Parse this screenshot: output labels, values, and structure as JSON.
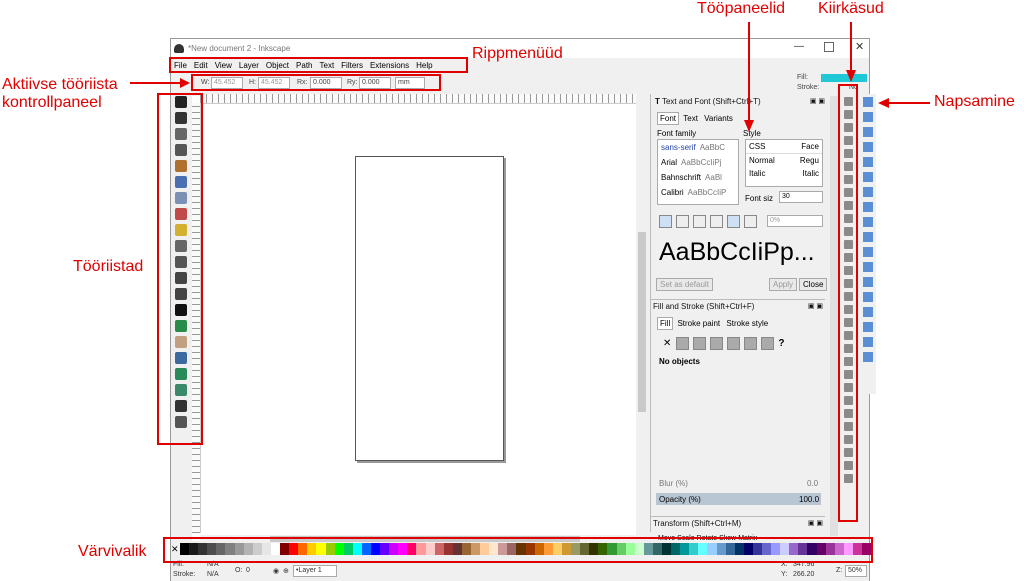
{
  "window": {
    "title": "*New document 2 - Inkscape"
  },
  "menu": [
    "File",
    "Edit",
    "View",
    "Layer",
    "Object",
    "Path",
    "Text",
    "Filters",
    "Extensions",
    "Help"
  ],
  "tool_controls": {
    "w_label": "W:",
    "w_value": "45.452",
    "h_label": "H:",
    "h_value": "45.452",
    "rx_label": "Rx:",
    "rx_value": "0.000",
    "ry_label": "Ry:",
    "ry_value": "0.000",
    "unit": "mm"
  },
  "fill_stroke_indicator": {
    "fill_label": "Fill:",
    "stroke_label": "Stroke:",
    "stroke_value": "No",
    "fill_color": "#1ec8d6"
  },
  "tools": [
    "selector-tool-icon",
    "node-tool-icon",
    "tweak-tool-icon",
    "zoom-tool-icon",
    "measure-tool-icon",
    "rectangle-tool-icon",
    "3dbox-tool-icon",
    "ellipse-tool-icon",
    "star-tool-icon",
    "spiral-tool-icon",
    "pencil-tool-icon",
    "pen-tool-icon",
    "calligraphy-tool-icon",
    "text-tool-icon",
    "spray-tool-icon",
    "eraser-tool-icon",
    "bucket-tool-icon",
    "gradient-tool-icon",
    "mesh-tool-icon",
    "dropper-tool-icon",
    "connector-tool-icon"
  ],
  "text_font_panel": {
    "title": "Text and Font (Shift+Ctrl+T)",
    "tabs": [
      "Font",
      "Text",
      "Variants"
    ],
    "font_family_label": "Font family",
    "font_families": [
      {
        "name": "sans-serif",
        "sample": "AaBbC"
      },
      {
        "name": "Arial",
        "sample": "AaBbCcIiPj"
      },
      {
        "name": "Bahnschrift",
        "sample": "AaBl"
      },
      {
        "name": "Calibri",
        "sample": "AaBbCcIiP"
      }
    ],
    "style_label": "Style",
    "style_headers": [
      "CSS",
      "Face"
    ],
    "styles": [
      [
        "Normal",
        "Regu"
      ],
      [
        "Italic",
        "Italic"
      ]
    ],
    "font_size_label": "Font siz",
    "font_size_value": "30",
    "spacing_value": "0%",
    "preview_text": "AaBbCcIiPp...",
    "set_default_button": "Set as default",
    "apply_button": "Apply",
    "close_button": "Close"
  },
  "fill_stroke_panel": {
    "title": "Fill and Stroke (Shift+Ctrl+F)",
    "tabs": [
      "Fill",
      "Stroke paint",
      "Stroke style"
    ],
    "status": "No objects",
    "unknown_paint": "?",
    "blur_label": "Blur (%)",
    "blur_value": "0.0",
    "opacity_label": "Opacity (%)",
    "opacity_value": "100.0"
  },
  "transform_panel": {
    "title": "Transform (Shift+Ctrl+M)",
    "tabs": [
      "Move",
      "Scale",
      "Rotate",
      "Skew",
      "Matrix"
    ]
  },
  "statusbar": {
    "fill_label": "Fill:",
    "fill_value": "N/A",
    "stroke_label": "Stroke:",
    "stroke_value": "N/A",
    "opacity_label": "O:",
    "opacity_value": "0",
    "layer": "•Layer 1",
    "x_label": "X:",
    "x_value": "347.96",
    "y_label": "Y:",
    "y_value": "266.20",
    "zoom_label": "Z:",
    "zoom_value": "50%"
  },
  "palette": [
    "#000000",
    "#1a1a1a",
    "#333333",
    "#4d4d4d",
    "#666666",
    "#808080",
    "#999999",
    "#b3b3b3",
    "#cccccc",
    "#e6e6e6",
    "#ffffff",
    "#800000",
    "#ff0000",
    "#ff6600",
    "#ffcc00",
    "#ffff00",
    "#99cc00",
    "#00ff00",
    "#00cc66",
    "#00ffff",
    "#0066ff",
    "#0000ff",
    "#6600ff",
    "#cc00ff",
    "#ff00ff",
    "#ff0066",
    "#ff9999",
    "#ffcccc",
    "#cc6666",
    "#993333",
    "#663333",
    "#996633",
    "#cc9966",
    "#ffcc99",
    "#ffe6cc",
    "#cc9999",
    "#996666",
    "#663300",
    "#993300",
    "#cc6600",
    "#ff9933",
    "#ffcc66",
    "#cc9933",
    "#999966",
    "#666633",
    "#333300",
    "#336600",
    "#339933",
    "#66cc66",
    "#99ff99",
    "#ccffcc",
    "#669999",
    "#336666",
    "#003333",
    "#006666",
    "#009999",
    "#33cccc",
    "#66ffff",
    "#99ccff",
    "#6699cc",
    "#336699",
    "#003366",
    "#000066",
    "#333399",
    "#6666cc",
    "#9999ff",
    "#ccccff",
    "#9966cc",
    "#663399",
    "#330066",
    "#660066",
    "#993399",
    "#cc66cc",
    "#ff99ff",
    "#cc3399",
    "#990066"
  ],
  "annotations": {
    "rippmenuud": "Rippmenüüd",
    "toopaneelid": "Tööpaneelid",
    "kiirkasud": "Kiirkäsud",
    "control_panel": "Aktiivse tööriista kontrollpaneel",
    "napsamine": "Napsamine",
    "toolbox": "Tööriistad",
    "palette": "Värvivalik"
  }
}
